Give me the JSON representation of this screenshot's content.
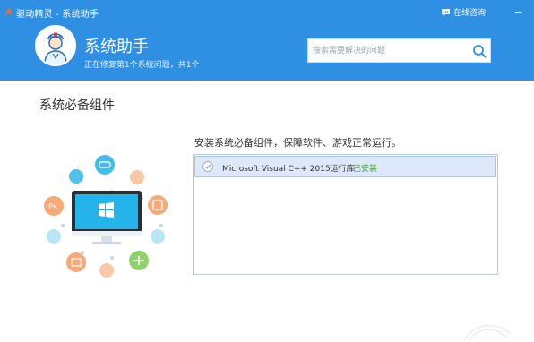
{
  "window": {
    "title": "驱动精灵 - 系统助手",
    "consult_label": "在线咨询"
  },
  "header": {
    "title": "系统助手",
    "subtitle": "正在修复第1个系统问题，共1个"
  },
  "search": {
    "placeholder": "搜索需要解决的问题"
  },
  "section": {
    "title": "系统必备组件",
    "description": "安装系统必备组件，保障软件、游戏正常运行。"
  },
  "components": [
    {
      "name": "Microsoft Visual C++ 2015运行库",
      "status": "已安装"
    }
  ],
  "colors": {
    "header_bg": "#2f8fe3",
    "status_installed": "#3aa332",
    "row_selected": "#dde9f8"
  },
  "illustration": {
    "center": "monitor-windows-icon",
    "bubbles": [
      "gamepad-icon",
      "ps-icon",
      "office-icon",
      "video-icon",
      "game-controller-icon"
    ]
  }
}
